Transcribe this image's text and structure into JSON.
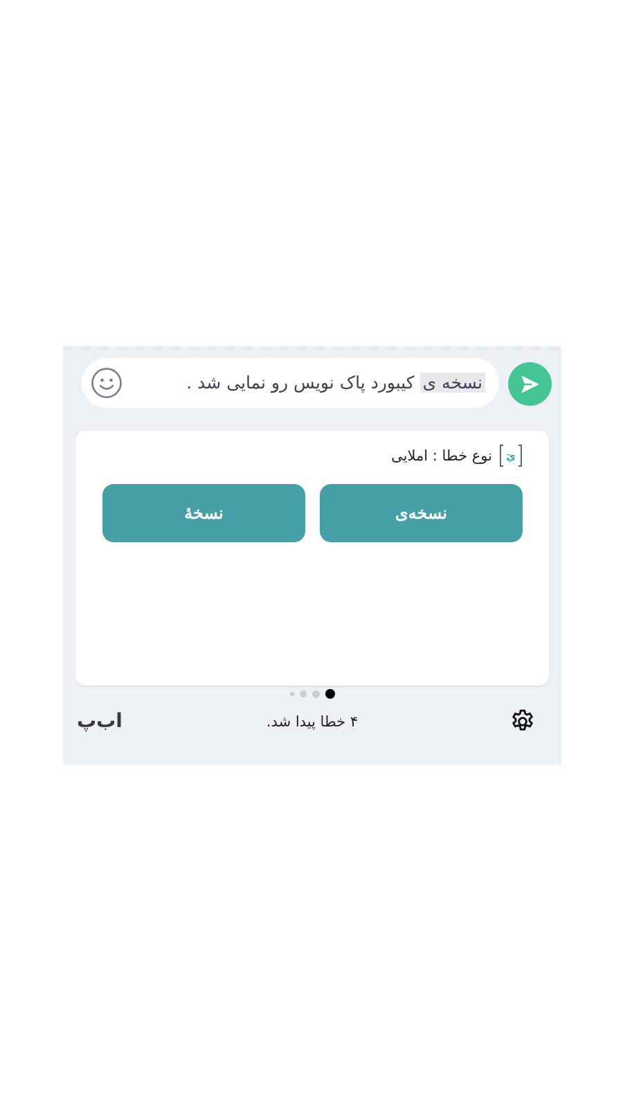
{
  "input": {
    "highlighted_word": "نسخه ی",
    "rest_text": " کیبورد پاک نویس رو نمایی شد ."
  },
  "icons": {
    "send": "send-arrow-icon",
    "emoji": "smiley-face-icon",
    "error_type": "spelling-icon",
    "settings": "gear-icon"
  },
  "suggestion_card": {
    "error_type_text": "نوع خطا : املایی",
    "suggestions": [
      "نسخه‌ی",
      "نسخهٔ"
    ]
  },
  "pagination": {
    "total": 4,
    "active_index": 0
  },
  "footer": {
    "status_text": "۴  خطا پیدا شد.",
    "brand": "اب‌پ"
  },
  "colors": {
    "accent_green": "#43c596",
    "suggestion_teal": "#47a0a8",
    "panel_bg": "#eef1f4"
  }
}
